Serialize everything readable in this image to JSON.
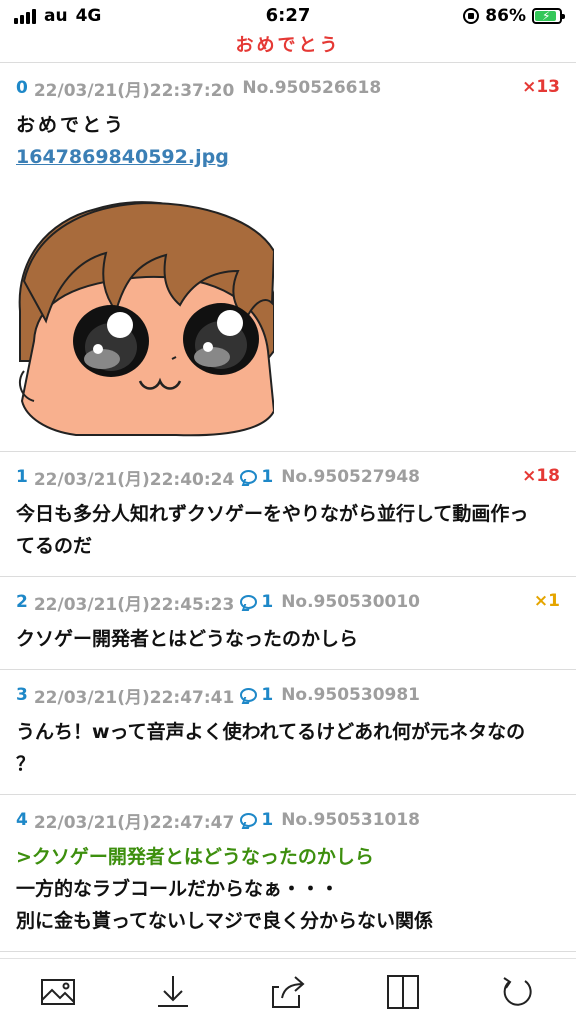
{
  "status": {
    "carrier": "au",
    "network": "4G",
    "time": "6:27",
    "battery_percent": "86%",
    "battery_level": 0.86,
    "signal_bars": 4,
    "icons": [
      "signal-icon",
      "orientation-lock-icon",
      "battery-charging-icon"
    ]
  },
  "header": {
    "title": "おめでとう"
  },
  "colors": {
    "title_red": "#e53935",
    "post_number_blue": "#1e88c8",
    "quote_green": "#3d8f0e",
    "likes_red": "#e53935",
    "likes_yellow": "#e5a500",
    "link_blue": "#3b7fb5"
  },
  "posts": [
    {
      "num": "0",
      "datetime": "22/03/21(月)22:37:20",
      "no": "No.950526618",
      "likes": "×13",
      "body": [
        "おめでとう"
      ],
      "file": "1647869840592.jpg",
      "image": "cartoon-face-image"
    },
    {
      "num": "1",
      "datetime": "22/03/21(月)22:40:24",
      "replies": "1",
      "no": "No.950527948",
      "likes": "×18",
      "body": [
        "今日も多分人知れずクソゲーをやりながら並行して動画作っ",
        "てるのだ"
      ]
    },
    {
      "num": "2",
      "datetime": "22/03/21(月)22:45:23",
      "replies": "1",
      "no": "No.950530010",
      "likes": "×1",
      "body": [
        "クソゲー開発者とはどうなったのかしら"
      ]
    },
    {
      "num": "3",
      "datetime": "22/03/21(月)22:47:41",
      "replies": "1",
      "no": "No.950530981",
      "body": [
        "うんち！wって音声よく使われてるけどあれ何が元ネタなの",
        "？"
      ]
    },
    {
      "num": "4",
      "datetime": "22/03/21(月)22:47:47",
      "replies": "1",
      "no": "No.950531018",
      "quote": ">クソゲー開発者とはどうなったのかしら",
      "body": [
        "一方的なラブコールだからなぁ・・・",
        "別に金も貰ってないしマジで良く分からない関係"
      ]
    }
  ],
  "toolbar": {
    "items": [
      "image-icon",
      "download-icon",
      "share-icon",
      "split-view-icon",
      "reload-icon"
    ]
  }
}
